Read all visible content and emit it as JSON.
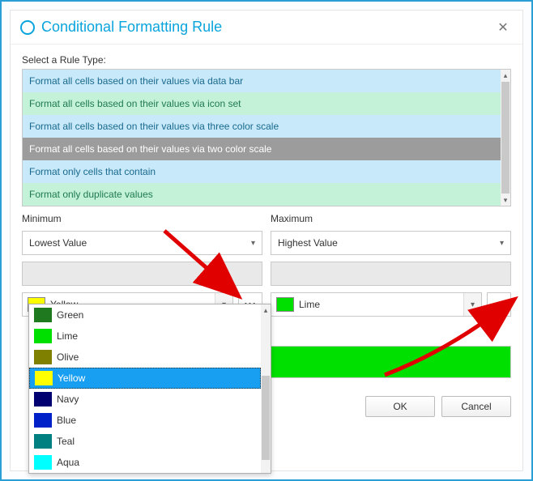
{
  "dialog": {
    "title": "Conditional Formatting Rule",
    "close_symbol": "✕"
  },
  "rule_type": {
    "label": "Select a Rule Type:",
    "items": [
      "Format all cells based on their values via data bar",
      "Format all cells based on their values via icon set",
      "Format all cells based on their values via three color scale",
      "Format all cells based on their values via two color scale",
      "Format only cells that contain",
      "Format only duplicate values"
    ],
    "selected_index": 3
  },
  "minimum": {
    "label": "Minimum",
    "value_type": "Lowest Value",
    "color_name": "Yellow",
    "color_hex": "#ffff00"
  },
  "maximum": {
    "label": "Maximum",
    "value_type": "Highest Value",
    "color_name": "Lime",
    "color_hex": "#00e000"
  },
  "color_dropdown": {
    "items": [
      {
        "name": "Green",
        "hex": "#1f7a1f"
      },
      {
        "name": "Lime",
        "hex": "#00e000"
      },
      {
        "name": "Olive",
        "hex": "#808000"
      },
      {
        "name": "Yellow",
        "hex": "#ffff00"
      },
      {
        "name": "Navy",
        "hex": "#000070"
      },
      {
        "name": "Blue",
        "hex": "#0020c8"
      },
      {
        "name": "Teal",
        "hex": "#008080"
      },
      {
        "name": "Aqua",
        "hex": "#00ffff"
      }
    ],
    "selected_index": 3
  },
  "buttons": {
    "ok": "OK",
    "cancel": "Cancel"
  },
  "glyphs": {
    "chev_down": "▾",
    "scroll_up": "▴",
    "scroll_down": "▾",
    "more": "•••"
  }
}
